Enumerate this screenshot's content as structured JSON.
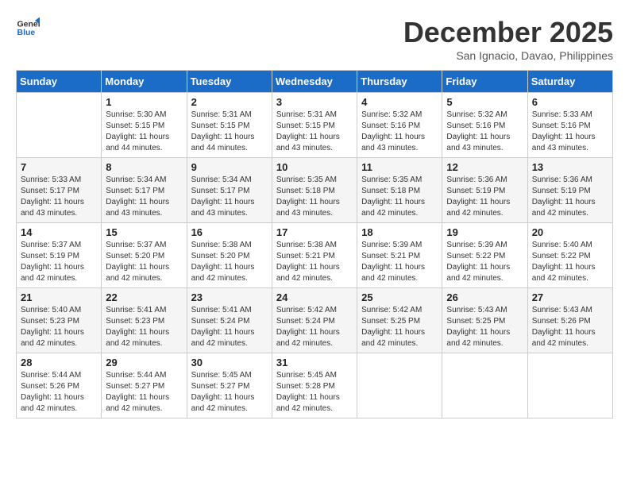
{
  "logo": {
    "line1": "General",
    "line2": "Blue"
  },
  "title": "December 2025",
  "subtitle": "San Ignacio, Davao, Philippines",
  "days_header": [
    "Sunday",
    "Monday",
    "Tuesday",
    "Wednesday",
    "Thursday",
    "Friday",
    "Saturday"
  ],
  "weeks": [
    [
      {
        "day": "",
        "info": ""
      },
      {
        "day": "1",
        "info": "Sunrise: 5:30 AM\nSunset: 5:15 PM\nDaylight: 11 hours\nand 44 minutes."
      },
      {
        "day": "2",
        "info": "Sunrise: 5:31 AM\nSunset: 5:15 PM\nDaylight: 11 hours\nand 44 minutes."
      },
      {
        "day": "3",
        "info": "Sunrise: 5:31 AM\nSunset: 5:15 PM\nDaylight: 11 hours\nand 43 minutes."
      },
      {
        "day": "4",
        "info": "Sunrise: 5:32 AM\nSunset: 5:16 PM\nDaylight: 11 hours\nand 43 minutes."
      },
      {
        "day": "5",
        "info": "Sunrise: 5:32 AM\nSunset: 5:16 PM\nDaylight: 11 hours\nand 43 minutes."
      },
      {
        "day": "6",
        "info": "Sunrise: 5:33 AM\nSunset: 5:16 PM\nDaylight: 11 hours\nand 43 minutes."
      }
    ],
    [
      {
        "day": "7",
        "info": "Sunrise: 5:33 AM\nSunset: 5:17 PM\nDaylight: 11 hours\nand 43 minutes."
      },
      {
        "day": "8",
        "info": "Sunrise: 5:34 AM\nSunset: 5:17 PM\nDaylight: 11 hours\nand 43 minutes."
      },
      {
        "day": "9",
        "info": "Sunrise: 5:34 AM\nSunset: 5:17 PM\nDaylight: 11 hours\nand 43 minutes."
      },
      {
        "day": "10",
        "info": "Sunrise: 5:35 AM\nSunset: 5:18 PM\nDaylight: 11 hours\nand 43 minutes."
      },
      {
        "day": "11",
        "info": "Sunrise: 5:35 AM\nSunset: 5:18 PM\nDaylight: 11 hours\nand 42 minutes."
      },
      {
        "day": "12",
        "info": "Sunrise: 5:36 AM\nSunset: 5:19 PM\nDaylight: 11 hours\nand 42 minutes."
      },
      {
        "day": "13",
        "info": "Sunrise: 5:36 AM\nSunset: 5:19 PM\nDaylight: 11 hours\nand 42 minutes."
      }
    ],
    [
      {
        "day": "14",
        "info": "Sunrise: 5:37 AM\nSunset: 5:19 PM\nDaylight: 11 hours\nand 42 minutes."
      },
      {
        "day": "15",
        "info": "Sunrise: 5:37 AM\nSunset: 5:20 PM\nDaylight: 11 hours\nand 42 minutes."
      },
      {
        "day": "16",
        "info": "Sunrise: 5:38 AM\nSunset: 5:20 PM\nDaylight: 11 hours\nand 42 minutes."
      },
      {
        "day": "17",
        "info": "Sunrise: 5:38 AM\nSunset: 5:21 PM\nDaylight: 11 hours\nand 42 minutes."
      },
      {
        "day": "18",
        "info": "Sunrise: 5:39 AM\nSunset: 5:21 PM\nDaylight: 11 hours\nand 42 minutes."
      },
      {
        "day": "19",
        "info": "Sunrise: 5:39 AM\nSunset: 5:22 PM\nDaylight: 11 hours\nand 42 minutes."
      },
      {
        "day": "20",
        "info": "Sunrise: 5:40 AM\nSunset: 5:22 PM\nDaylight: 11 hours\nand 42 minutes."
      }
    ],
    [
      {
        "day": "21",
        "info": "Sunrise: 5:40 AM\nSunset: 5:23 PM\nDaylight: 11 hours\nand 42 minutes."
      },
      {
        "day": "22",
        "info": "Sunrise: 5:41 AM\nSunset: 5:23 PM\nDaylight: 11 hours\nand 42 minutes."
      },
      {
        "day": "23",
        "info": "Sunrise: 5:41 AM\nSunset: 5:24 PM\nDaylight: 11 hours\nand 42 minutes."
      },
      {
        "day": "24",
        "info": "Sunrise: 5:42 AM\nSunset: 5:24 PM\nDaylight: 11 hours\nand 42 minutes."
      },
      {
        "day": "25",
        "info": "Sunrise: 5:42 AM\nSunset: 5:25 PM\nDaylight: 11 hours\nand 42 minutes."
      },
      {
        "day": "26",
        "info": "Sunrise: 5:43 AM\nSunset: 5:25 PM\nDaylight: 11 hours\nand 42 minutes."
      },
      {
        "day": "27",
        "info": "Sunrise: 5:43 AM\nSunset: 5:26 PM\nDaylight: 11 hours\nand 42 minutes."
      }
    ],
    [
      {
        "day": "28",
        "info": "Sunrise: 5:44 AM\nSunset: 5:26 PM\nDaylight: 11 hours\nand 42 minutes."
      },
      {
        "day": "29",
        "info": "Sunrise: 5:44 AM\nSunset: 5:27 PM\nDaylight: 11 hours\nand 42 minutes."
      },
      {
        "day": "30",
        "info": "Sunrise: 5:45 AM\nSunset: 5:27 PM\nDaylight: 11 hours\nand 42 minutes."
      },
      {
        "day": "31",
        "info": "Sunrise: 5:45 AM\nSunset: 5:28 PM\nDaylight: 11 hours\nand 42 minutes."
      },
      {
        "day": "",
        "info": ""
      },
      {
        "day": "",
        "info": ""
      },
      {
        "day": "",
        "info": ""
      }
    ]
  ]
}
